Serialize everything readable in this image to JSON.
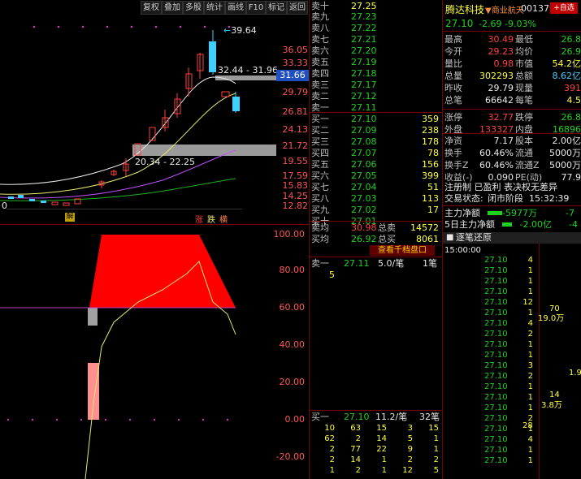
{
  "toolbar": {
    "items": [
      "复权",
      "叠加",
      "多股",
      "统计",
      "画线",
      "F10",
      "标记",
      "返回"
    ]
  },
  "kline": {
    "high_marker": "39.64",
    "price_axis": [
      "36.05",
      "33.33",
      "31.66",
      "29.79",
      "26.81",
      "24.13",
      "21.72",
      "19.55",
      "17.59",
      "15.83",
      "14.25",
      "12.82"
    ],
    "current_tag": "31.66",
    "range_top": "32.44 - 31.96",
    "range_bottom": "20.34 - 22.25",
    "left_zero": "0",
    "markers": [
      "解",
      "涨",
      "跌",
      "横"
    ]
  },
  "indicator": {
    "axis": [
      "100.00",
      "80.00",
      "60.00",
      "40.00",
      "20.00",
      "0.00",
      "-20.00"
    ]
  },
  "stock": {
    "name": "腾达科技",
    "industry": "▼商业航天",
    "code": "001379",
    "add_button": "+自选",
    "price": "27.10",
    "change": "-2.69",
    "pct": "-9.03%"
  },
  "asks": [
    {
      "label": "卖十",
      "price": "27.25",
      "vol": ""
    },
    {
      "label": "卖九",
      "price": "27.23",
      "vol": ""
    },
    {
      "label": "卖八",
      "price": "27.22",
      "vol": ""
    },
    {
      "label": "卖七",
      "price": "27.21",
      "vol": ""
    },
    {
      "label": "卖六",
      "price": "27.20",
      "vol": ""
    },
    {
      "label": "卖五",
      "price": "27.19",
      "vol": ""
    },
    {
      "label": "卖四",
      "price": "27.18",
      "vol": ""
    },
    {
      "label": "卖三",
      "price": "27.17",
      "vol": ""
    },
    {
      "label": "卖二",
      "price": "27.12",
      "vol": ""
    },
    {
      "label": "卖一",
      "price": "27.11",
      "vol": ""
    }
  ],
  "bids": [
    {
      "label": "买一",
      "price": "27.10",
      "vol": "359"
    },
    {
      "label": "买二",
      "price": "27.09",
      "vol": "238"
    },
    {
      "label": "买三",
      "price": "27.08",
      "vol": "178"
    },
    {
      "label": "买四",
      "price": "27.07",
      "vol": "78"
    },
    {
      "label": "买五",
      "price": "27.06",
      "vol": "156"
    },
    {
      "label": "买六",
      "price": "27.05",
      "vol": "399"
    },
    {
      "label": "买七",
      "price": "27.04",
      "vol": "51"
    },
    {
      "label": "买八",
      "price": "27.03",
      "vol": "113"
    },
    {
      "label": "买九",
      "price": "27.02",
      "vol": "17"
    },
    {
      "label": "买十",
      "price": "27.01",
      "vol": ""
    }
  ],
  "avg": {
    "sell_label": "卖均",
    "sell_price": "30.98",
    "sell_total_label": "总卖",
    "sell_total": "14572",
    "buy_label": "买均",
    "buy_price": "26.92",
    "buy_total_label": "总买",
    "buy_total": "8061"
  },
  "queue_button": "查看千档盘口",
  "sell_queue": {
    "label": "卖一",
    "price": "27.11",
    "ratio": "5.0/笔",
    "count": "1笔",
    "items": [
      "5"
    ]
  },
  "buy_queue": {
    "label": "买一",
    "price": "27.10",
    "ratio": "11.2/笔",
    "count": "32笔",
    "rows": [
      [
        "10",
        "63",
        "15",
        "3",
        "15"
      ],
      [
        "62",
        "2",
        "14",
        "5",
        "1"
      ],
      [
        "2",
        "77",
        "22",
        "9",
        "1"
      ],
      [
        "2",
        "14",
        "1",
        "2",
        "2"
      ],
      [
        "1",
        "2",
        "1",
        "12",
        "5"
      ]
    ]
  },
  "quote": [
    {
      "l": "最高",
      "v": "30.49",
      "l2": "最低",
      "v2": "26.8"
    },
    {
      "l": "今开",
      "v": "29.23",
      "l2": "均价",
      "v2": "26.9"
    },
    {
      "l": "量比",
      "v": "0.98",
      "l2": "市值",
      "v2": "54.2亿"
    },
    {
      "l": "总量",
      "v": "302293",
      "l2": "总额",
      "v2": "8.62亿"
    },
    {
      "l": "昨收",
      "v": "29.79",
      "l2": "现量",
      "v2": "391"
    },
    {
      "l": "总笔",
      "v": "66642",
      "l2": "每笔",
      "v2": "4.5"
    }
  ],
  "quote2": [
    {
      "l": "涨停",
      "v": "32.77",
      "l2": "跌停",
      "v2": "26.8"
    },
    {
      "l": "外盘",
      "v": "133327",
      "l2": "内盘",
      "v2": "16896"
    }
  ],
  "quote3": [
    {
      "l": "净资",
      "v": "7.17",
      "l2": "股本",
      "v2": "2.00亿"
    },
    {
      "l": "换手",
      "v": "60.46%",
      "l2": "流通",
      "v2": "5000万"
    },
    {
      "l": "换手Z",
      "v": "60.46%",
      "l2": "流通Z",
      "v2": "5000万"
    },
    {
      "l": "收益(-)",
      "v": "0.090",
      "l2": "PE(动)",
      "v2": "77.9"
    }
  ],
  "reg_line": "注册制 已盈利 表决权无差异",
  "trade_status": {
    "label": "交易状态:",
    "value": "闭市阶段",
    "time": "15:32:39"
  },
  "flow": [
    {
      "label": "主力净额",
      "value": "-5977万",
      "extra": "-7"
    },
    {
      "label": "5日主力净额",
      "value": "-2.00亿",
      "extra": "-4"
    }
  ],
  "ticks": {
    "title": "逐笔还原",
    "first_time": "15:00:00",
    "prices": [
      "27.10",
      "27.10",
      "27.10",
      "27.10",
      "27.10",
      "27.10",
      "27.10",
      "27.10",
      "27.10",
      "27.10",
      "27.10",
      "27.10",
      "27.10",
      "27.10",
      "27.10",
      "27.10",
      "27.10",
      "27.10",
      "27.10",
      "27.10"
    ],
    "vols": [
      "4",
      "1",
      "1",
      "1",
      "12",
      "1",
      "4",
      "2",
      "1",
      "1",
      "3",
      "2",
      "1",
      "1",
      "1",
      "2",
      "1",
      "4",
      "1",
      "1"
    ],
    "big": [
      {
        "v": "70",
        "u": "19.0万"
      },
      {
        "v": "14",
        "u": "3.8万"
      },
      {
        "v": "28",
        "u": ""
      },
      {
        "v": "",
        "u": "1.9万"
      }
    ]
  },
  "colors": {
    "up": "#ff4040",
    "down": "#20d020",
    "cyan": "#40d0ff",
    "ma_yellow": "#e8e870",
    "ma_purple": "#c050ff"
  }
}
